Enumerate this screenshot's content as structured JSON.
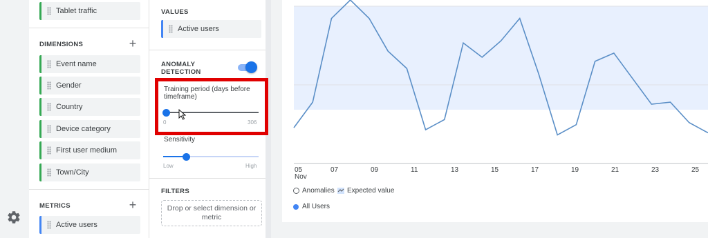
{
  "variables_panel": {
    "top_item": "Tablet traffic",
    "dimensions_title": "DIMENSIONS",
    "dimensions": [
      "Event name",
      "Gender",
      "Country",
      "Device category",
      "First user medium",
      "Town/City"
    ],
    "metrics_title": "METRICS",
    "metrics": [
      "Active users"
    ]
  },
  "settings_panel": {
    "values_title": "VALUES",
    "values_item": "Active users",
    "anomaly_title_line1": "ANOMALY",
    "anomaly_title_line2": "DETECTION",
    "anomaly_enabled": true,
    "training_period_label": "Training period (days before timeframe)",
    "training_min": "0",
    "training_max": "306",
    "training_value_fraction": 0.0,
    "sensitivity_label": "Sensitivity",
    "sensitivity_low": "Low",
    "sensitivity_high": "High",
    "sensitivity_value_fraction": 0.24,
    "filters_title": "FILTERS",
    "filters_placeholder": "Drop or select dimension or metric"
  },
  "chart": {
    "x_ticks": [
      "05",
      "07",
      "09",
      "11",
      "13",
      "15",
      "17",
      "19",
      "21",
      "23",
      "25"
    ],
    "x_month": "Nov",
    "legend_anomalies": "Anomalies",
    "legend_expected": "Expected value",
    "legend_series": "All Users",
    "line_color": "#5b8fc7",
    "band_color": "#e8f0fe"
  },
  "chart_data": {
    "type": "line",
    "categories": [
      "04",
      "05",
      "06",
      "07",
      "08",
      "09",
      "10",
      "11",
      "12",
      "13",
      "14",
      "15",
      "16",
      "17",
      "18",
      "19",
      "20",
      "21",
      "22",
      "23",
      "24",
      "25",
      "26"
    ],
    "series": [
      {
        "name": "All Users",
        "values": [
          125,
          100,
          18,
          0,
          18,
          50,
          67,
          127,
          117,
          42,
          56,
          40,
          18,
          72,
          132,
          122,
          60,
          52,
          77,
          102,
          100,
          120,
          130
        ]
      }
    ]
  },
  "colors": {
    "accent": "#1a73e8",
    "dimension_chip_border": "#34a853",
    "metric_chip_border": "#4285f4",
    "highlight": "#e00000"
  }
}
